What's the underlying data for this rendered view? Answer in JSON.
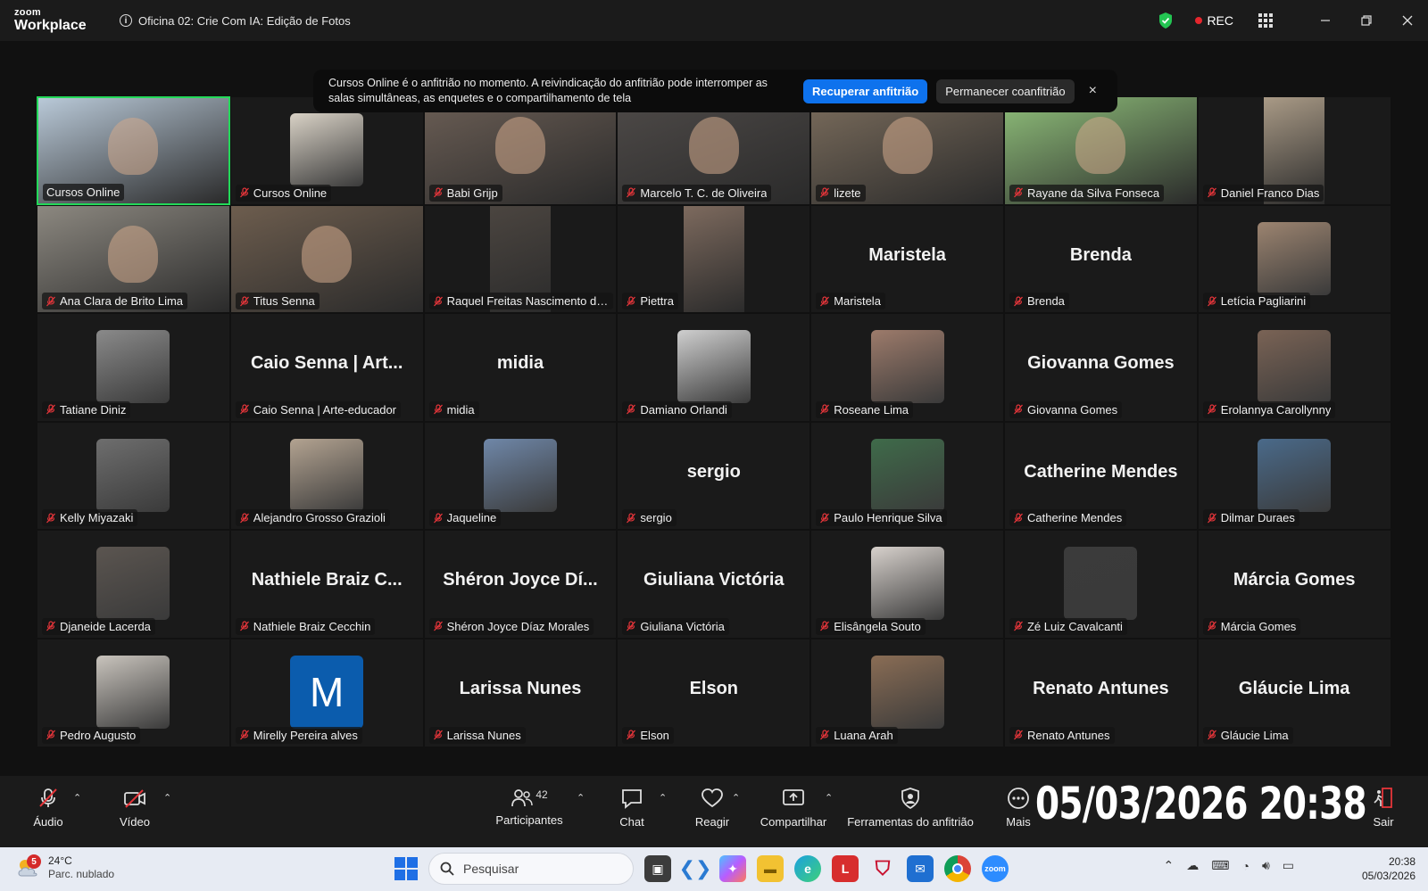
{
  "app": {
    "logo_top": "zoom",
    "logo_bottom": "Workplace",
    "meeting_title": "Oficina 02: Crie Com IA: Edição de Fotos",
    "rec_label": "REC",
    "colors": {
      "accent_blue": "#0e72ed",
      "active_speaker": "#23d959",
      "rec_red": "#e5262d",
      "mute_red": "#e5353a"
    }
  },
  "notice": {
    "text": "Cursos Online é o anfitrião no momento. A reivindicação do anfitrião pode interromper as salas simultâneas, as enquetes e o compartilhamento de tela",
    "reclaim_label": "Recuperar anfitrião",
    "stay_label": "Permanecer coanfitrião",
    "close_glyph": "×"
  },
  "participants": [
    {
      "name": "Cursos Online",
      "type": "video",
      "color": "#b9c9d8",
      "active": true,
      "muted": false
    },
    {
      "name": "Cursos Online",
      "type": "avatar",
      "color": "#d9d2c6"
    },
    {
      "name": "Babi Grijp",
      "type": "video",
      "color": "#6b5e55"
    },
    {
      "name": "Marcelo T. C. de  Oliveira",
      "type": "video",
      "color": "#4e4a48"
    },
    {
      "name": "lizete",
      "type": "video",
      "color": "#7a6c5c"
    },
    {
      "name": "Rayane da Silva Fonseca",
      "type": "video",
      "color": "#8fbf7a"
    },
    {
      "name": "Daniel Franco Dias",
      "type": "video-narrow",
      "color": "#a99a86"
    },
    {
      "name": "Ana Clara de Brito Lima",
      "type": "video",
      "color": "#8c8880"
    },
    {
      "name": "Titus Senna",
      "type": "video",
      "color": "#6d5d4e"
    },
    {
      "name": "Raquel Freitas Nascimento dos ...",
      "type": "video-narrow",
      "color": "#4b4540"
    },
    {
      "name": "Piettra",
      "type": "video-narrow",
      "color": "#7d6a5e"
    },
    {
      "name": "Maristela",
      "type": "text",
      "display": "Maristela"
    },
    {
      "name": "Brenda",
      "type": "text",
      "display": "Brenda"
    },
    {
      "name": "Letícia Pagliarini",
      "type": "avatar",
      "color": "#9c8470"
    },
    {
      "name": "Tatiane Diniz",
      "type": "avatar",
      "color": "#8a8a8a"
    },
    {
      "name": "Caio Senna | Arte-educador",
      "type": "text",
      "display": "Caio Senna | Art..."
    },
    {
      "name": "midia",
      "type": "text",
      "display": "midia"
    },
    {
      "name": "Damiano Orlandi",
      "type": "avatar",
      "color": "#cfcfcf"
    },
    {
      "name": "Roseane Lima",
      "type": "avatar",
      "color": "#9d7b6b"
    },
    {
      "name": "Giovanna Gomes",
      "type": "text",
      "display": "Giovanna Gomes"
    },
    {
      "name": "Erolannya Carollynny",
      "type": "avatar",
      "color": "#7a6355"
    },
    {
      "name": "Kelly Miyazaki",
      "type": "avatar",
      "color": "#6e6e6e"
    },
    {
      "name": "Alejandro Grosso Grazioli",
      "type": "avatar",
      "color": "#b3a391"
    },
    {
      "name": "Jaqueline",
      "type": "avatar",
      "color": "#6f87a8"
    },
    {
      "name": "sergio",
      "type": "text",
      "display": "sergio"
    },
    {
      "name": "Paulo Henrique Silva",
      "type": "avatar",
      "color": "#3f6b4a"
    },
    {
      "name": "Catherine Mendes",
      "type": "text",
      "display": "Catherine Mendes"
    },
    {
      "name": "Dilmar Duraes",
      "type": "avatar",
      "color": "#4a6a8a"
    },
    {
      "name": "Djaneide Lacerda",
      "type": "avatar",
      "color": "#5b5550"
    },
    {
      "name": "Nathiele Braiz Cecchin",
      "type": "text",
      "display": "Nathiele Braiz C..."
    },
    {
      "name": "Shéron Joyce Díaz Morales",
      "type": "text",
      "display": "Shéron Joyce Dí..."
    },
    {
      "name": "Giuliana Victória",
      "type": "text",
      "display": "Giuliana Victória"
    },
    {
      "name": "Elisângela Souto",
      "type": "avatar",
      "color": "#d7d1cc"
    },
    {
      "name": "Zé Luiz Cavalcanti",
      "type": "avatar",
      "color": "#3b3b3b"
    },
    {
      "name": "Márcia Gomes",
      "type": "text",
      "display": "Márcia Gomes"
    },
    {
      "name": "Pedro Augusto",
      "type": "avatar",
      "color": "#c9c4bd"
    },
    {
      "name": "Mirelly Pereira alves",
      "type": "initial",
      "display": "M"
    },
    {
      "name": "Larissa Nunes",
      "type": "text",
      "display": "Larissa Nunes"
    },
    {
      "name": "Elson",
      "type": "text",
      "display": "Elson"
    },
    {
      "name": "Luana Arah",
      "type": "avatar",
      "color": "#8a6d55"
    },
    {
      "name": "Renato Antunes",
      "type": "text",
      "display": "Renato Antunes"
    },
    {
      "name": "Gláucie Lima",
      "type": "text",
      "display": "Gláucie Lima"
    }
  ],
  "toolbar": {
    "audio_label": "Áudio",
    "video_label": "Vídeo",
    "participants_label": "Participantes",
    "participants_count": "42",
    "chat_label": "Chat",
    "react_label": "Reagir",
    "share_label": "Compartilhar",
    "host_tools_label": "Ferramentas do anfitrião",
    "more_label": "Mais",
    "leave_label": "Sair",
    "overlay_datetime": "05/03/2026 20:38"
  },
  "taskbar": {
    "weather_temp": "24°C",
    "weather_desc": "Parc. nublado",
    "weather_badge": "5",
    "search_placeholder": "Pesquisar",
    "time": "20:38",
    "date": "05/03/2026"
  }
}
